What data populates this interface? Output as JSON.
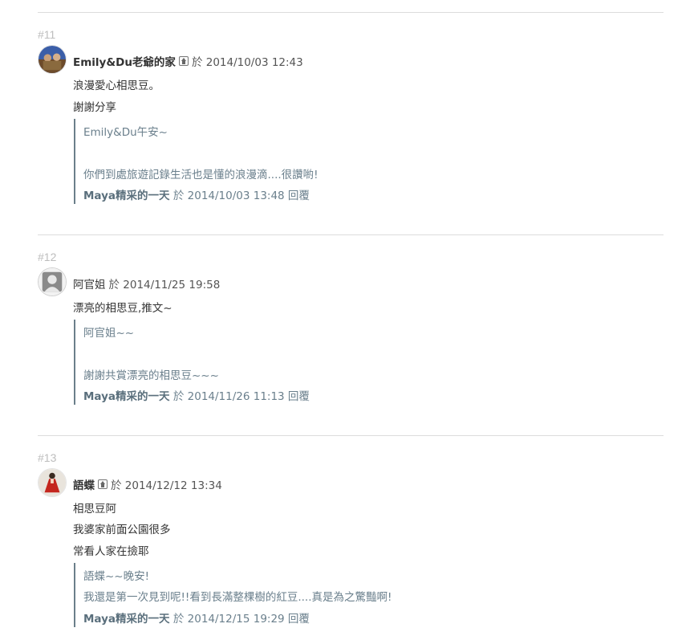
{
  "comments": [
    {
      "number": "#11",
      "author": "Emily&Du老爺的家",
      "has_home_icon": true,
      "meta": "於 2014/10/03 12:43",
      "lines": [
        "浪漫愛心相思豆。",
        "謝謝分享"
      ],
      "reply": {
        "lines": [
          "Emily&Du午安~",
          "",
          "你們到處旅遊記錄生活也是懂的浪漫滴....很讚喲!"
        ],
        "replier": "Maya精采的一天",
        "meta": "於 2014/10/03 13:48 回覆"
      }
    },
    {
      "number": "#12",
      "author": "阿官姐",
      "has_home_icon": false,
      "meta": "於 2014/11/25 19:58",
      "lines": [
        "漂亮的相思豆,推文~"
      ],
      "reply": {
        "lines": [
          "阿官姐~~",
          "",
          "謝謝共賞漂亮的相思豆~~~"
        ],
        "replier": "Maya精采的一天",
        "meta": "於 2014/11/26 11:13 回覆"
      }
    },
    {
      "number": "#13",
      "author": "語蝶",
      "has_home_icon": true,
      "meta": "於 2014/12/12 13:34",
      "lines": [
        "相思豆阿",
        "我婆家前面公園很多",
        "常看人家在撿耶"
      ],
      "reply": {
        "lines": [
          "語蝶~~晚安!",
          "我還是第一次見到呢!!看到長滿整棵樹的紅豆....真是為之驚豔啊!"
        ],
        "replier": "Maya精采的一天",
        "meta": "於 2014/12/15 19:29 回覆"
      }
    }
  ]
}
